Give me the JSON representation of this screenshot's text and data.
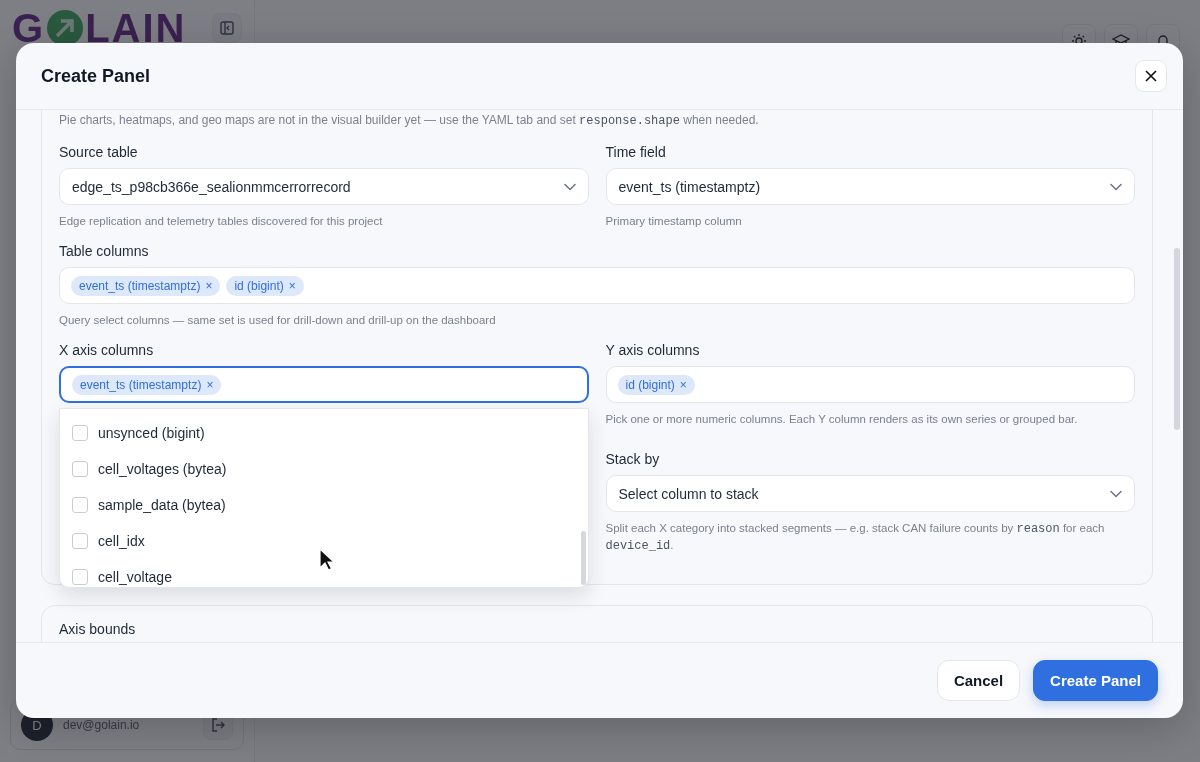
{
  "background": {
    "logo": {
      "left": "G",
      "right": "LAIN"
    },
    "user": {
      "initial": "D",
      "email": "dev@golain.io"
    }
  },
  "dialog": {
    "title": "Create Panel",
    "note": [
      {
        "kind": "text",
        "text": "Pie charts, heatmaps, and geo maps are not in the visual builder yet — use the YAML tab and set "
      },
      {
        "kind": "code",
        "text": "response.shape"
      },
      {
        "kind": "text",
        "text": " when needed."
      }
    ],
    "sections": [
      {
        "columns": [
          [
            {
              "kind": "select",
              "focused": false,
              "label": "Source table",
              "value": "edge_ts_p98cb366e_sealionmmcerrorrecord",
              "help": [
                {
                  "kind": "text",
                  "text": "Edge replication and telemetry tables discovered for this project"
                }
              ]
            }
          ],
          [
            {
              "kind": "select",
              "focused": false,
              "label": "Time field",
              "value": "event_ts (timestamptz)",
              "help": [
                {
                  "kind": "text",
                  "text": "Primary timestamp column"
                }
              ]
            }
          ]
        ]
      },
      {
        "columns": [
          [
            {
              "kind": "chips",
              "focused": false,
              "label": "Table columns",
              "chips": [
                {
                  "label": "event_ts (timestamptz)",
                  "remove": "×"
                },
                {
                  "label": "id (bigint)",
                  "remove": "×"
                }
              ],
              "help": [
                {
                  "kind": "text",
                  "text": "Query select columns — same set is used for drill-down and drill-up on the dashboard"
                }
              ]
            }
          ]
        ]
      },
      {
        "columns": [
          [
            {
              "kind": "chips",
              "focused": true,
              "label": "X axis columns",
              "chips": [
                {
                  "label": "event_ts (timestamptz)",
                  "remove": "×"
                }
              ],
              "dropdown": [
                {
                  "label": "unsynced (bigint)",
                  "checked": false
                },
                {
                  "label": "cell_voltages (bytea)",
                  "checked": false
                },
                {
                  "label": "sample_data (bytea)",
                  "checked": false
                },
                {
                  "label": "cell_idx",
                  "checked": false
                },
                {
                  "label": "cell_voltage",
                  "checked": false
                }
              ]
            }
          ],
          [
            {
              "kind": "chips",
              "focused": false,
              "label": "Y axis columns",
              "chips": [
                {
                  "label": "id (bigint)",
                  "remove": "×"
                }
              ],
              "help": [
                {
                  "kind": "text",
                  "text": "Pick one or more numeric columns. Each Y column renders as its own series or grouped bar."
                }
              ]
            },
            {
              "kind": "select",
              "focused": false,
              "label": "Stack by",
              "placeholder": "Select column to stack",
              "help": [
                {
                  "kind": "text",
                  "text": "Split each X category into stacked segments — e.g. stack CAN failure counts by "
                },
                {
                  "kind": "code",
                  "text": "reason"
                },
                {
                  "kind": "text",
                  "text": " for each "
                },
                {
                  "kind": "code",
                  "text": "device_id"
                },
                {
                  "kind": "text",
                  "text": "."
                }
              ]
            }
          ]
        ]
      }
    ],
    "next_section": "Axis bounds",
    "buttons": [
      {
        "label": "Cancel",
        "kind": "secondary"
      },
      {
        "label": "Create Panel",
        "kind": "primary"
      }
    ]
  }
}
